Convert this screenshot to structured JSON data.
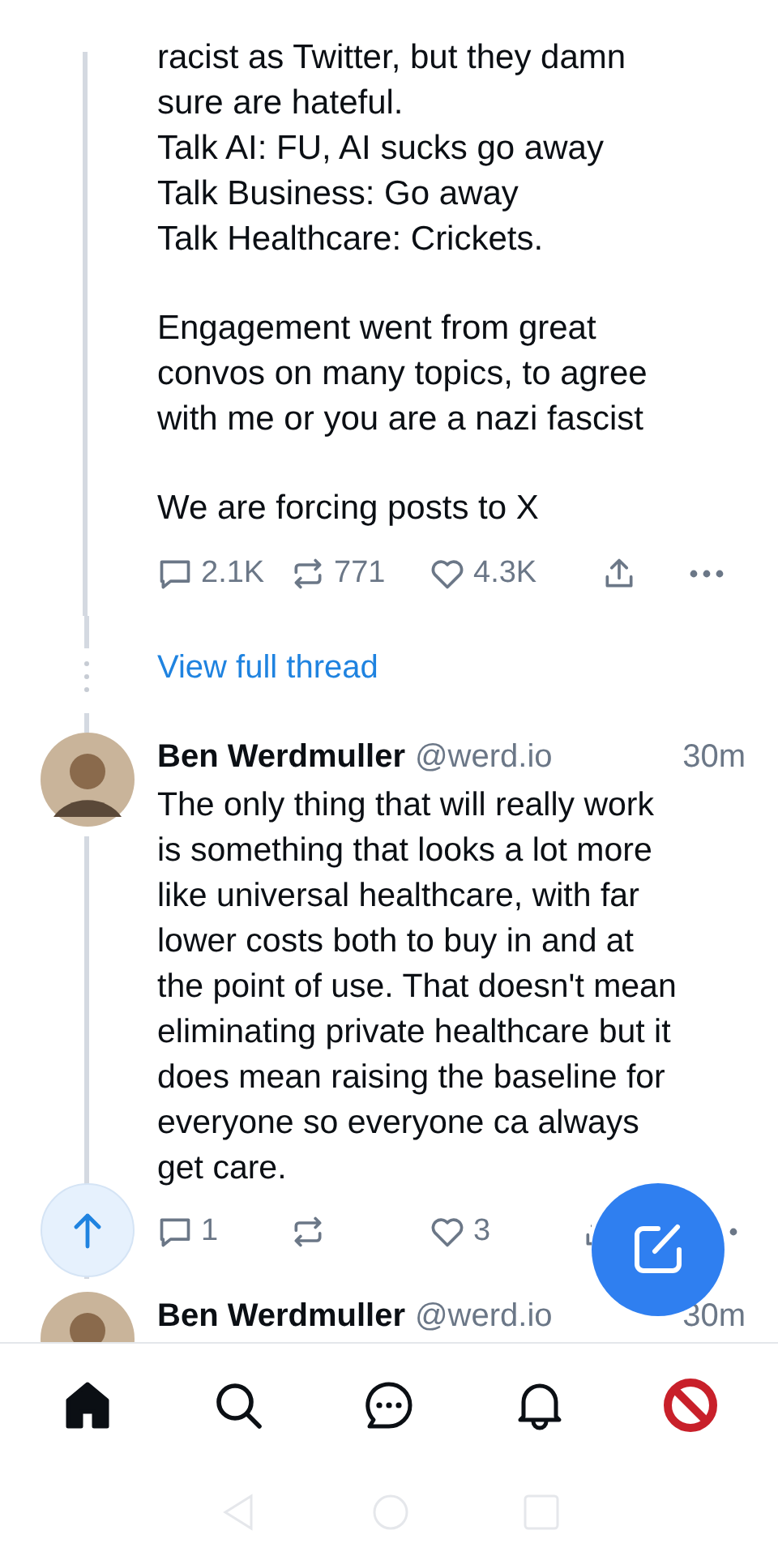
{
  "thread_post": {
    "paragraphs": [
      "racist as Twitter, but they damn\nsure are hateful.\nTalk AI: FU, AI sucks go away\nTalk Business: Go away\nTalk Healthcare:  Crickets.",
      "Engagement went from great\nconvos on many topics, to agree\nwith me or you are a nazi fascist",
      "We are forcing  posts to X"
    ],
    "replies": "2.1K",
    "reposts": "771",
    "likes": "4.3K"
  },
  "view_full_thread": "View full thread",
  "posts": [
    {
      "author": "Ben Werdmuller",
      "handle": "@werd.io",
      "time": "30m",
      "text": "The only thing that will really work\nis something that looks a lot more\nlike universal healthcare, with far\nlower costs both to buy in and at\nthe point of use. That doesn't mean\neliminating private healthcare but it\ndoes mean raising the baseline for\neveryone so everyone ca always\nget care.",
      "replies": "1",
      "likes": "3"
    },
    {
      "author": "Ben Werdmuller",
      "handle": "@werd.io",
      "time": "30m"
    }
  ],
  "nav": [
    {
      "kind": "home",
      "selected": true
    },
    {
      "kind": "search",
      "selected": false
    },
    {
      "kind": "chat",
      "selected": false
    },
    {
      "kind": "notifications",
      "selected": false
    },
    {
      "kind": "profile",
      "selected": false
    }
  ]
}
